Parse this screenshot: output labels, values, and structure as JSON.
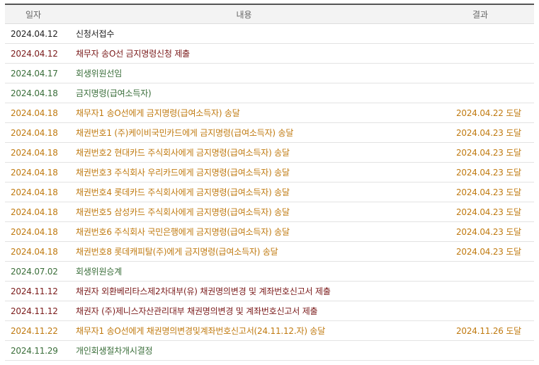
{
  "table": {
    "headers": {
      "date": "일자",
      "content": "내용",
      "result": "결과"
    },
    "rows": [
      {
        "date": "2024.04.12",
        "content": "신청서접수",
        "result": "",
        "tone": "black"
      },
      {
        "date": "2024.04.12",
        "content": "채무자 송O선 금지명령신청 제출",
        "result": "",
        "tone": "maroon"
      },
      {
        "date": "2024.04.17",
        "content": "회생위원선임",
        "result": "",
        "tone": "green"
      },
      {
        "date": "2024.04.18",
        "content": "금지명령(급여소득자)",
        "result": "",
        "tone": "green"
      },
      {
        "date": "2024.04.18",
        "content": "채무자1 송O선에게 금지명령(급여소득자) 송달",
        "result": "2024.04.22 도달",
        "tone": "orange"
      },
      {
        "date": "2024.04.18",
        "content": "채권번호1 (주)케이비국민카드에게 금지명령(급여소득자) 송달",
        "result": "2024.04.23 도달",
        "tone": "orange"
      },
      {
        "date": "2024.04.18",
        "content": "채권번호2 현대카드 주식회사에게 금지명령(급여소득자) 송달",
        "result": "2024.04.23 도달",
        "tone": "orange"
      },
      {
        "date": "2024.04.18",
        "content": "채권번호3 주식회사 우리카드에게 금지명령(급여소득자) 송달",
        "result": "2024.04.23 도달",
        "tone": "orange"
      },
      {
        "date": "2024.04.18",
        "content": "채권번호4 롯데카드 주식회사에게 금지명령(급여소득자) 송달",
        "result": "2024.04.23 도달",
        "tone": "orange"
      },
      {
        "date": "2024.04.18",
        "content": "채권번호5 삼성카드 주식회사에게 금지명령(급여소득자) 송달",
        "result": "2024.04.23 도달",
        "tone": "orange"
      },
      {
        "date": "2024.04.18",
        "content": "채권번호6 주식회사 국민은행에게 금지명령(급여소득자) 송달",
        "result": "2024.04.23 도달",
        "tone": "orange"
      },
      {
        "date": "2024.04.18",
        "content": "채권번호8 롯데캐피탈(주)에게 금지명령(급여소득자) 송달",
        "result": "2024.04.23 도달",
        "tone": "orange"
      },
      {
        "date": "2024.07.02",
        "content": "회생위원승계",
        "result": "",
        "tone": "green"
      },
      {
        "date": "2024.11.12",
        "content": "채권자 외환베리타스제2차대부(유) 채권명의변경 및 계좌번호신고서 제출",
        "result": "",
        "tone": "maroon"
      },
      {
        "date": "2024.11.12",
        "content": "채권자 (주)제니스자산관리대부 채권명의변경 및 계좌번호신고서 제출",
        "result": "",
        "tone": "maroon"
      },
      {
        "date": "2024.11.22",
        "content": "채무자1 송O선에게 채권명의변경및계좌번호신고서(24.11.12.자) 송달",
        "result": "2024.11.26 도달",
        "tone": "orange"
      },
      {
        "date": "2024.11.29",
        "content": "개인회생절차개시결정",
        "result": "",
        "tone": "green"
      }
    ]
  }
}
